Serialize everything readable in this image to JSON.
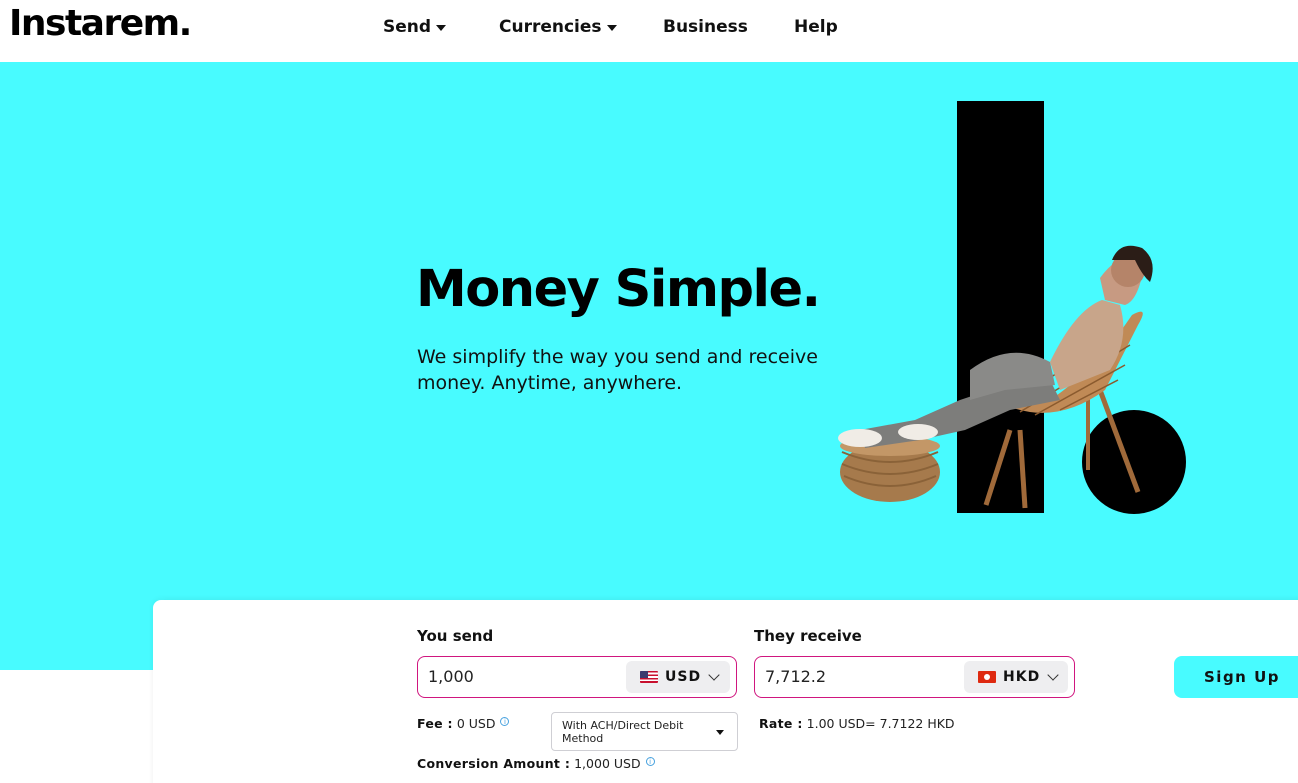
{
  "brand": {
    "logo_text": "Instarem."
  },
  "nav": {
    "send": "Send",
    "currencies": "Currencies",
    "business": "Business",
    "help": "Help"
  },
  "hero": {
    "title": "Money Simple.",
    "subtitle": "We simplify the way you send and receive money. Anytime, anywhere."
  },
  "calculator": {
    "send_label": "You send",
    "send_amount": "1,000",
    "send_currency": "USD",
    "receive_label": "They receive",
    "receive_amount": "7,712.2",
    "receive_currency": "HKD",
    "fee_label": "Fee :",
    "fee_value": "0 USD",
    "method": "With ACH/Direct Debit Method",
    "conversion_label": "Conversion Amount :",
    "conversion_value": "1,000 USD",
    "rate_label": "Rate :",
    "rate_value": "1.00 USD= 7.7122 HKD",
    "signup": "Sign Up"
  },
  "colors": {
    "hero_bg": "#48fbff",
    "field_border": "#d0167f",
    "text": "#111111"
  }
}
